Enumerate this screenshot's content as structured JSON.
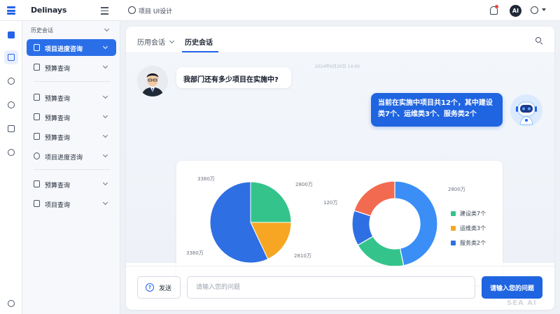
{
  "app": {
    "brand": "Delinays",
    "project_title": "项目 UI设计"
  },
  "header": {
    "user_badge": "AI",
    "colors": {
      "notification_dot": "#ef4444"
    }
  },
  "iconrail": {
    "icons": [
      "doc-blue-icon",
      "chat-doc-icon",
      "team-icon",
      "user-card-icon",
      "calendar-icon",
      "settings-icon",
      "clock-icon"
    ]
  },
  "sidebar": {
    "section_label": "历史会话",
    "items": [
      {
        "label": "项目进度咨询",
        "active": true
      },
      {
        "label": "预算查询"
      },
      {
        "label": "预算查询"
      },
      {
        "label": "预算查询"
      },
      {
        "label": "预算查询"
      },
      {
        "label": "项目进度咨询"
      },
      {
        "label": "预算查询"
      },
      {
        "label": "项目查询"
      }
    ]
  },
  "tabs": {
    "history": "历用会话",
    "current": "历史会话"
  },
  "chat": {
    "timestamp": "2024年6月20日 14:00",
    "question": "我部门还有多少项目在实施中?",
    "answer": "当前在实施中项目共12个，其中建设类7个、运维类3个、服务类2个"
  },
  "chart_data": [
    {
      "type": "pie",
      "labels": [
        "3380万",
        "2800万",
        "2810万",
        "3380万"
      ],
      "values": [
        25,
        18,
        57
      ],
      "colors": [
        "#34c48b",
        "#f6a623",
        "#2f6fe4"
      ]
    },
    {
      "type": "donut",
      "labels": [
        "120万",
        "2800万"
      ],
      "legend": [
        "建设类7个",
        "运维类3个",
        "服务类2个"
      ],
      "values": [
        7,
        3,
        2
      ],
      "colors": [
        "#3a8ef6",
        "#34c48b",
        "#2f6fe4",
        "#f26a4f"
      ]
    }
  ],
  "input": {
    "send_label": "发送",
    "placeholder": "请输入您的问题",
    "submit_label": "请输入您的问题"
  },
  "watermark": "SEA AI"
}
